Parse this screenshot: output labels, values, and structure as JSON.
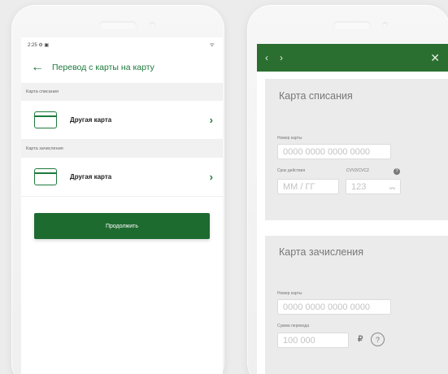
{
  "left_screen": {
    "status_bar": {
      "time": "2:25",
      "status_icons": "⚙ ▣",
      "wifi_icon": "ᯤ"
    },
    "header": {
      "back_icon": "←",
      "title": "Перевод с карты на карту"
    },
    "debit_section": {
      "label": "Карта списания",
      "card_label": "Другая карта"
    },
    "credit_section": {
      "label": "Карта зачисления",
      "card_label": "Другая карта"
    },
    "chevron_icon": "›",
    "continue_button": "Продолжить"
  },
  "right_screen": {
    "nav": {
      "back_icon": "‹",
      "forward_icon": "›",
      "close_icon": "✕"
    },
    "debit_panel": {
      "title": "Карта списания",
      "card_number_label": "Номер карты",
      "card_number_placeholder": "0000 0000 0000 0000",
      "expiry_label": "Срок действия",
      "expiry_placeholder": "ММ / ГГ",
      "cvv_label": "CVV2/CVC2",
      "cvv_placeholder": "123",
      "help_icon": "?",
      "eye_icon": "〰"
    },
    "credit_panel": {
      "title": "Карта зачисления",
      "card_number_label": "Номер карты",
      "card_number_placeholder": "0000 0000 0000 0000",
      "amount_label": "Сумма перевода",
      "amount_placeholder": "100 000",
      "currency_symbol": "₽",
      "help_icon": "?"
    }
  },
  "colors": {
    "brand_green": "#1e7a3c",
    "header_dark_green": "#2a6f2f",
    "panel_gray": "#ebebeb"
  }
}
